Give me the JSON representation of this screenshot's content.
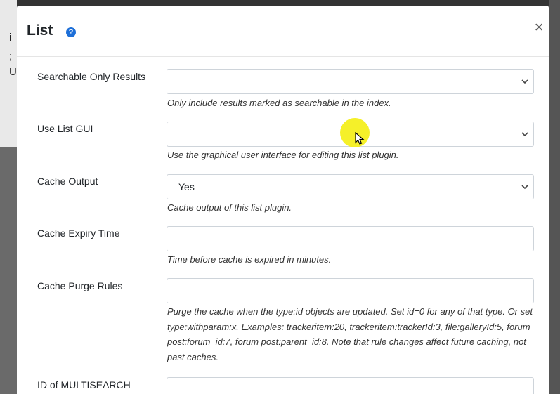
{
  "modal": {
    "title": "List",
    "close_label": "×",
    "help_icon": "question-circle-icon"
  },
  "fields": [
    {
      "label": "Searchable Only Results",
      "type": "select",
      "value": "",
      "help": "Only include results marked as searchable in the index."
    },
    {
      "label": "Use List GUI",
      "type": "select",
      "value": "",
      "help": "Use the graphical user interface for editing this list plugin."
    },
    {
      "label": "Cache Output",
      "type": "select",
      "value": "Yes",
      "help": "Cache output of this list plugin."
    },
    {
      "label": "Cache Expiry Time",
      "type": "text",
      "value": "",
      "help": "Time before cache is expired in minutes."
    },
    {
      "label": "Cache Purge Rules",
      "type": "text",
      "value": "",
      "help": "Purge the cache when the type:id objects are updated. Set id=0 for any of that type. Or set type:withparam:x. Examples: trackeritem:20, trackeritem:trackerId:3, file:galleryId:5, forum post:forum_id:7, forum post:parent_id:8. Note that rule changes affect future caching, not past caches."
    },
    {
      "label": "ID of MULTISEARCH",
      "type": "text",
      "value": "",
      "help": ""
    }
  ],
  "background": {
    "chars": [
      "i",
      ";",
      "U"
    ]
  },
  "colors": {
    "accent": "#1d6fd8",
    "cursor_highlight": "#f4ef1e",
    "field_border": "#ced4da"
  }
}
